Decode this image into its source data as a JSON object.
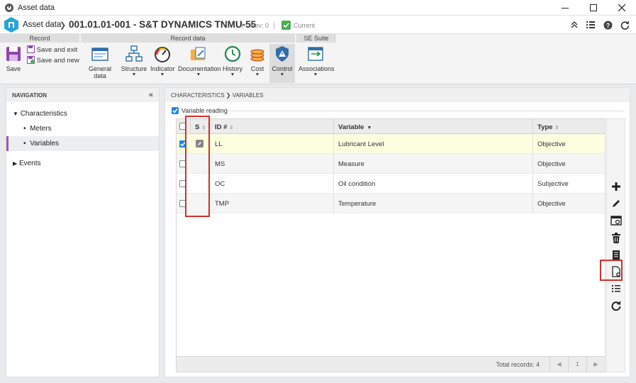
{
  "window": {
    "title": "Asset data"
  },
  "header": {
    "crumb": "Asset data",
    "record_title": "001.01.01-001 - S&T DYNAMICS TNMU-55",
    "rev": "Rev: 0",
    "status": "Current"
  },
  "ribbon": {
    "groups": {
      "record": "Record",
      "record_data": "Record data",
      "se_suite": "SE Suite"
    },
    "save": "Save",
    "save_exit": "Save and exit",
    "save_new": "Save and new",
    "buttons": {
      "general_data": "General data",
      "structure": "Structure",
      "indicator": "Indicator",
      "documentation": "Documentation",
      "history": "History",
      "cost": "Cost",
      "control": "Control",
      "associations": "Associations"
    }
  },
  "navigation": {
    "title": "NAVIGATION",
    "items": {
      "characteristics": "Characteristics",
      "meters": "Meters",
      "variables": "Variables",
      "events": "Events"
    }
  },
  "main": {
    "breadcrumb": "CHARACTERISTICS  ❯  VARIABLES",
    "variable_reading": "Variable reading",
    "columns": {
      "s": "S",
      "id": "ID #",
      "variable": "Variable",
      "type": "Type"
    },
    "rows": [
      {
        "id": "LL",
        "variable": "Lubricant Level",
        "type": "Objective"
      },
      {
        "id": "MS",
        "variable": "Measure",
        "type": "Objective"
      },
      {
        "id": "OC",
        "variable": "Oil condition",
        "type": "Subjective"
      },
      {
        "id": "TMP",
        "variable": "Temperature",
        "type": "Objective"
      }
    ],
    "total_records": "Total records: 4",
    "page": "1"
  },
  "colors": {
    "accent": "#1e88e5",
    "selected_row": "#fdfde0",
    "nav_marker": "#9b59b6",
    "highlight_box": "#d32f2f",
    "current_status": "#4caf50"
  }
}
